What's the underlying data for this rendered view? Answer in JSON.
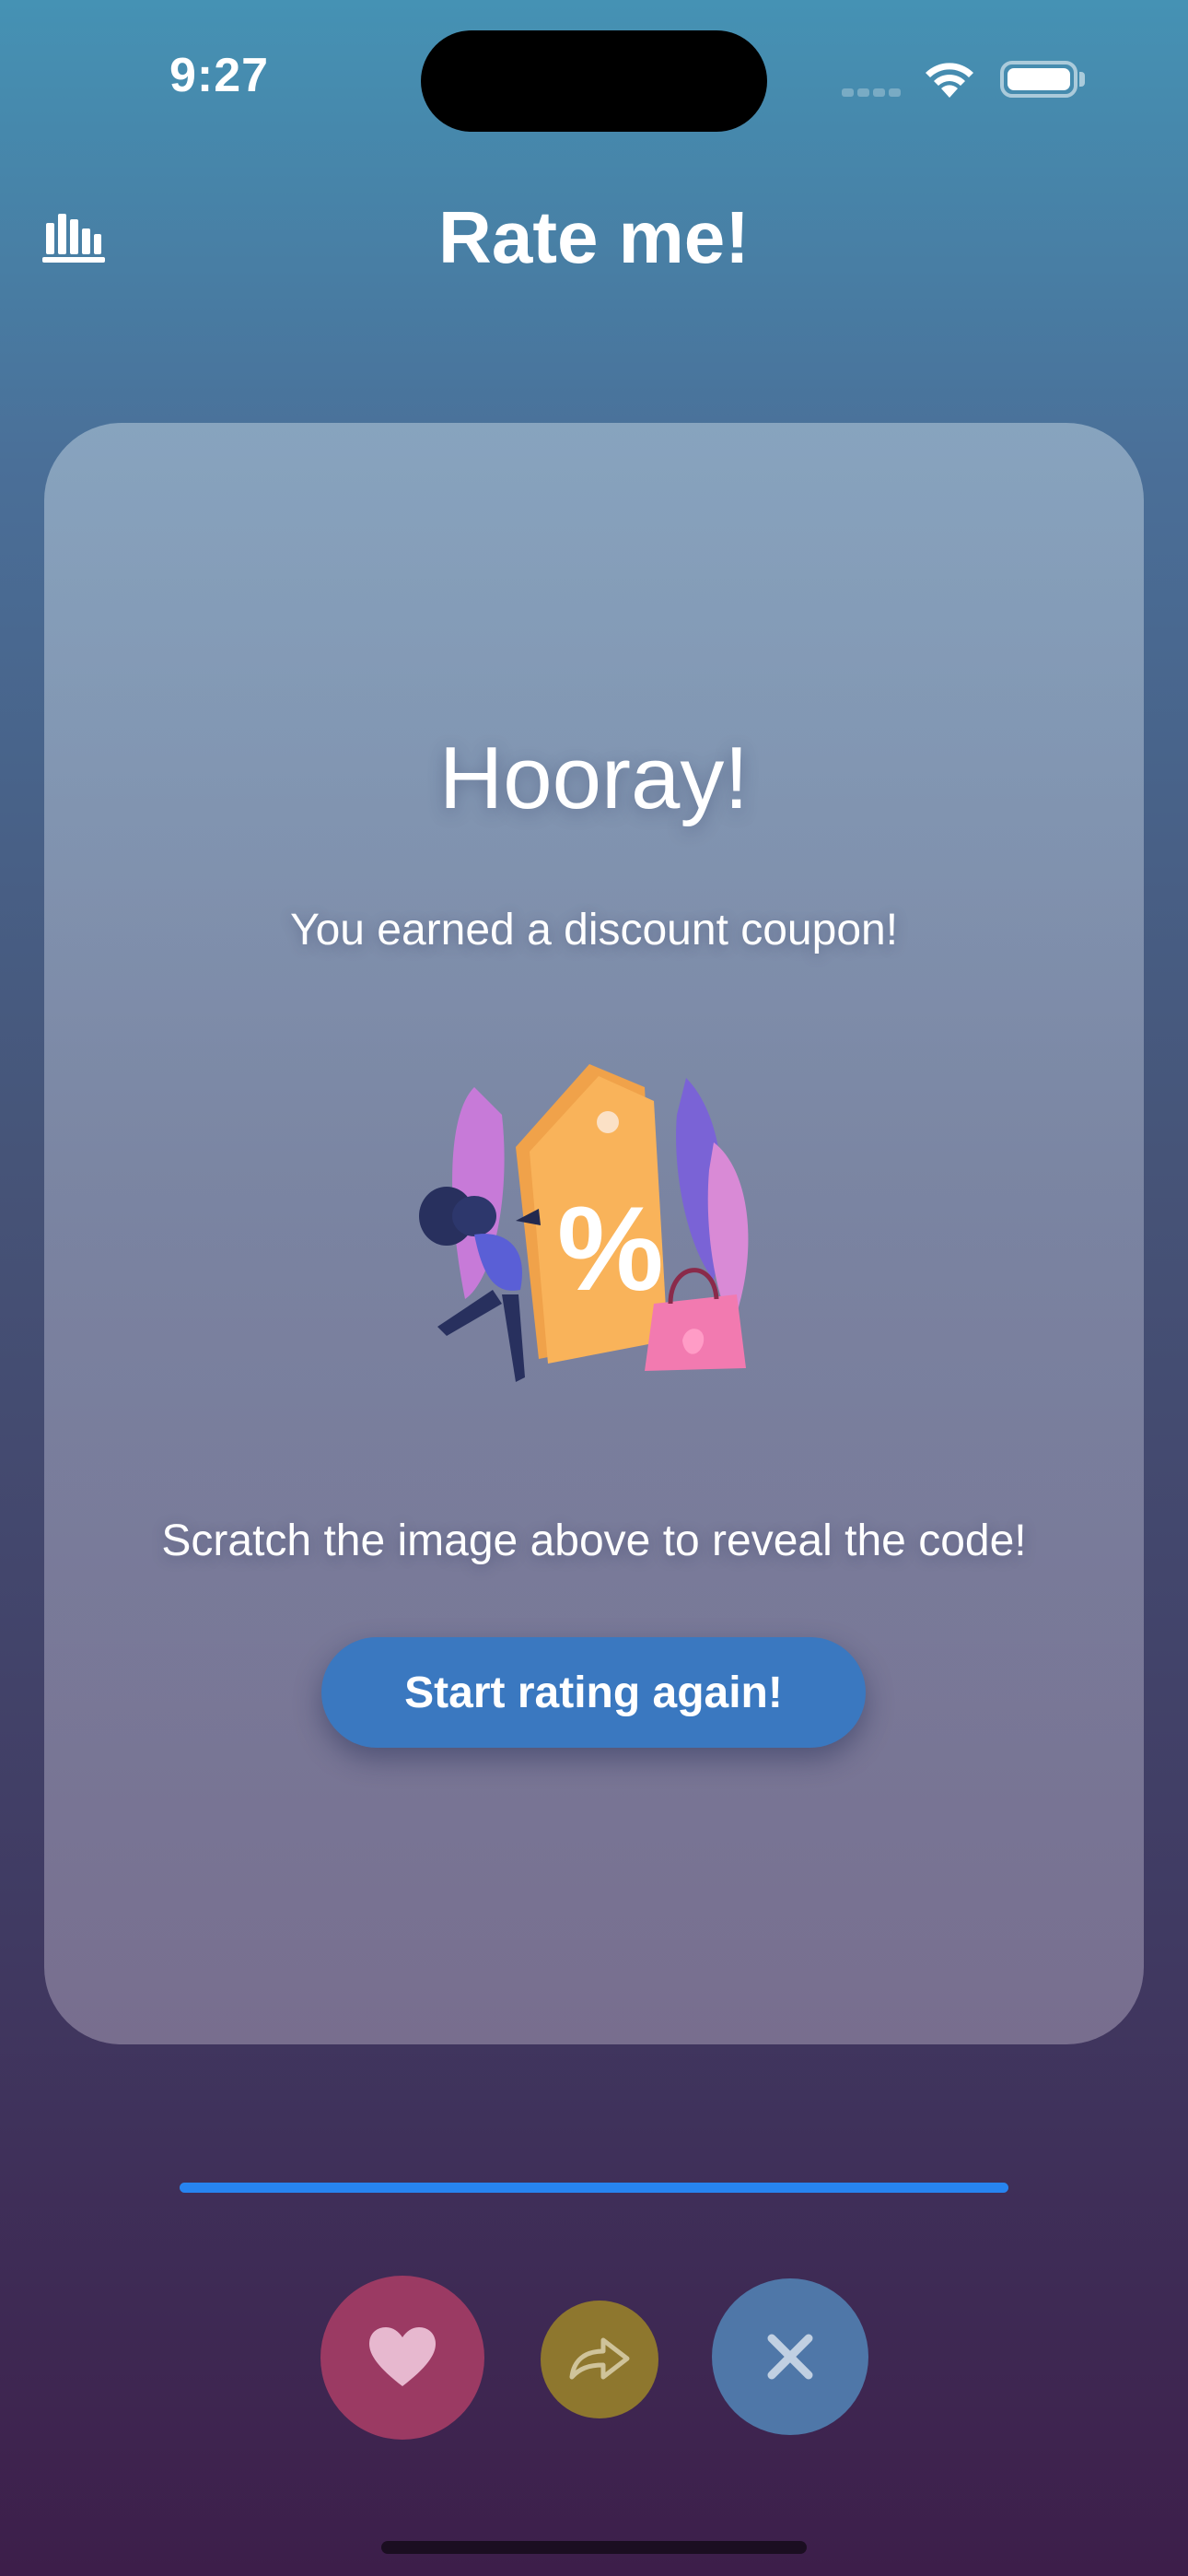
{
  "status_bar": {
    "time": "9:27",
    "wifi_icon": "wifi-icon",
    "battery_icon": "battery-full-icon"
  },
  "nav": {
    "title": "Rate me!",
    "stats_icon": "bar-chart-icon"
  },
  "card": {
    "heading": "Hooray!",
    "subtitle": "You earned a discount coupon!",
    "image": "discount-coupon-illustration",
    "instruction": "Scratch the image above to reveal the code!",
    "restart_label": "Start rating again!"
  },
  "progress": {
    "value_fraction": 1.0
  },
  "actions": {
    "like_icon": "heart-icon",
    "share_icon": "share-arrow-icon",
    "dislike_icon": "close-icon"
  },
  "colors": {
    "accent_blue": "#2784f0",
    "button_blue": "#3a78c0",
    "like": "#9b3a63",
    "share": "#8e772e",
    "dislike": "#4f77a8"
  }
}
